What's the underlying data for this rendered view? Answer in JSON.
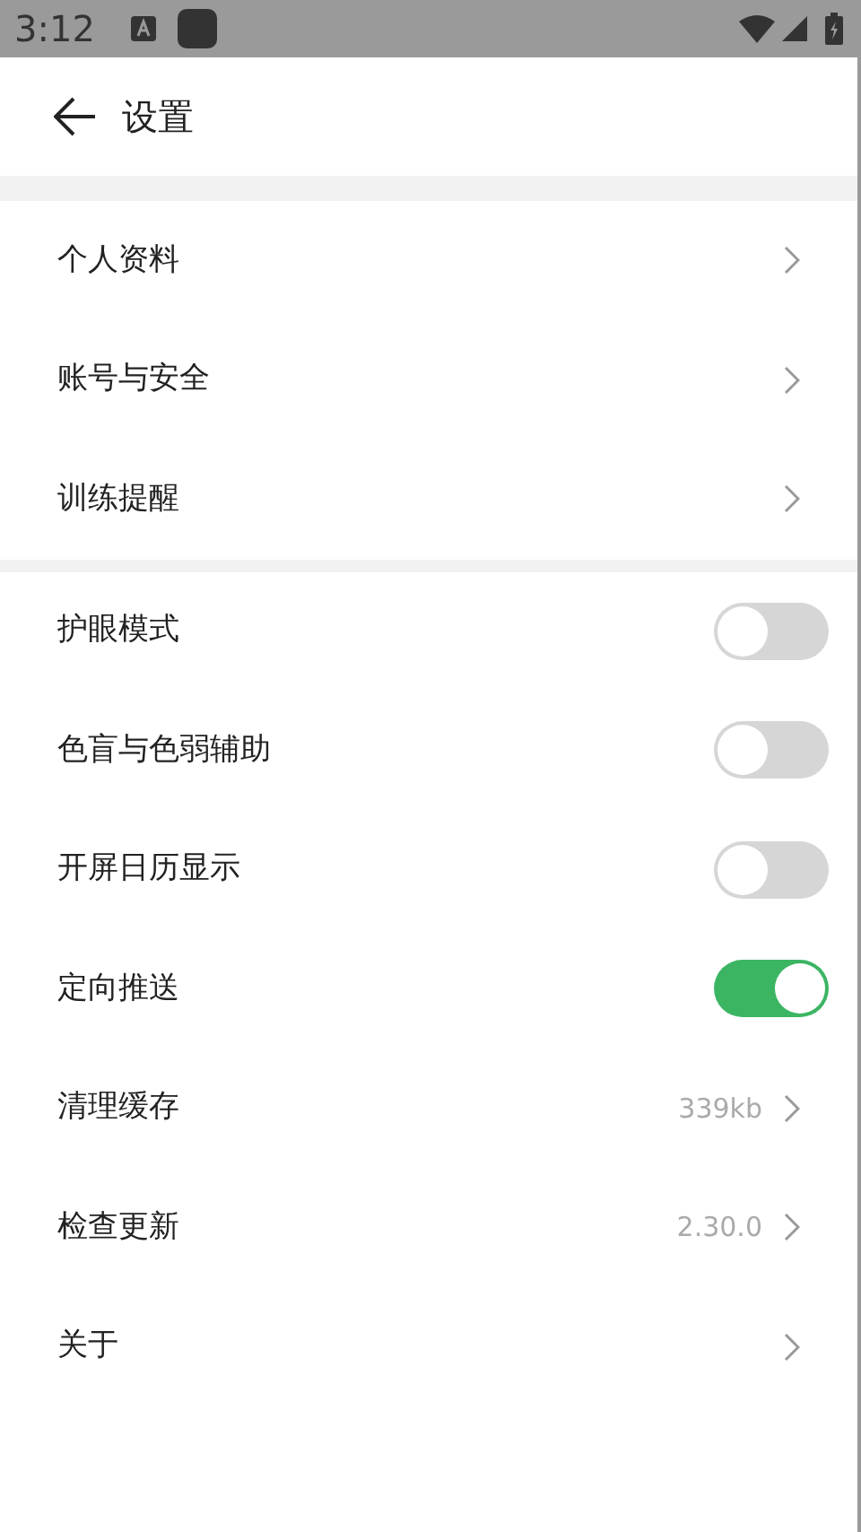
{
  "status_bar": {
    "time": "3:12"
  },
  "header": {
    "title": "设置"
  },
  "sections": [
    {
      "items": [
        {
          "kind": "link",
          "label": "个人资料"
        },
        {
          "kind": "link",
          "label": "账号与安全"
        },
        {
          "kind": "link",
          "label": "训练提醒"
        }
      ]
    },
    {
      "items": [
        {
          "kind": "toggle",
          "label": "护眼模式",
          "on": false
        },
        {
          "kind": "toggle",
          "label": "色盲与色弱辅助",
          "on": false
        },
        {
          "kind": "toggle",
          "label": "开屏日历显示",
          "on": false
        },
        {
          "kind": "toggle",
          "label": "定向推送",
          "on": true
        },
        {
          "kind": "value",
          "label": "清理缓存",
          "value": "339kb"
        },
        {
          "kind": "value",
          "label": "检查更新",
          "value": "2.30.0"
        },
        {
          "kind": "link",
          "label": "关于"
        }
      ]
    }
  ]
}
